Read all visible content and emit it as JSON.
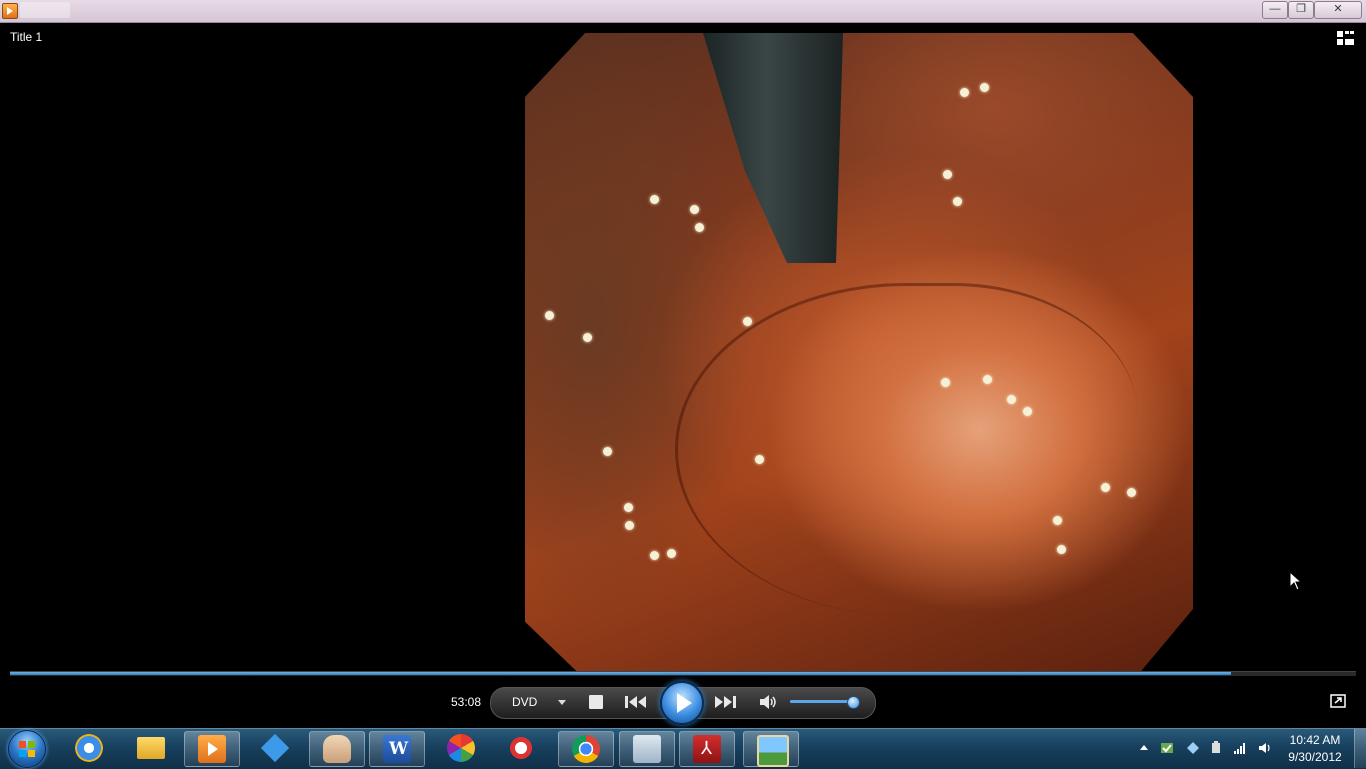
{
  "window": {
    "title_label": "Title 1",
    "controls": {
      "minimize": "—",
      "maximize": "❐",
      "close": "✕"
    }
  },
  "player": {
    "time": "53:08",
    "source": "DVD",
    "seek_progress_fraction": 0.907,
    "volume_fraction": 0.95,
    "icons": [
      "stop-icon",
      "previous-icon",
      "play-icon",
      "next-icon",
      "volume-icon",
      "switch-to-library-icon",
      "fullscreen-icon"
    ]
  },
  "taskbar": {
    "pinned": [
      "start-button",
      "internet-explorer-icon",
      "windows-explorer-icon",
      "windows-media-player-icon",
      "dropbox-icon",
      "hand-app-icon",
      "microsoft-word-icon",
      "picasa-icon",
      "snipping-tool-icon",
      "google-chrome-icon",
      "explorer-window-icon",
      "adobe-reader-icon",
      "photo-viewer-icon"
    ],
    "clock": {
      "time": "10:42 AM",
      "date": "9/30/2012"
    }
  },
  "colors": {
    "taskbar": "#18405e",
    "seek_fill": "#2d7fc2",
    "play_button": "#3b8de0",
    "titlebar": "#e2d4e1"
  }
}
